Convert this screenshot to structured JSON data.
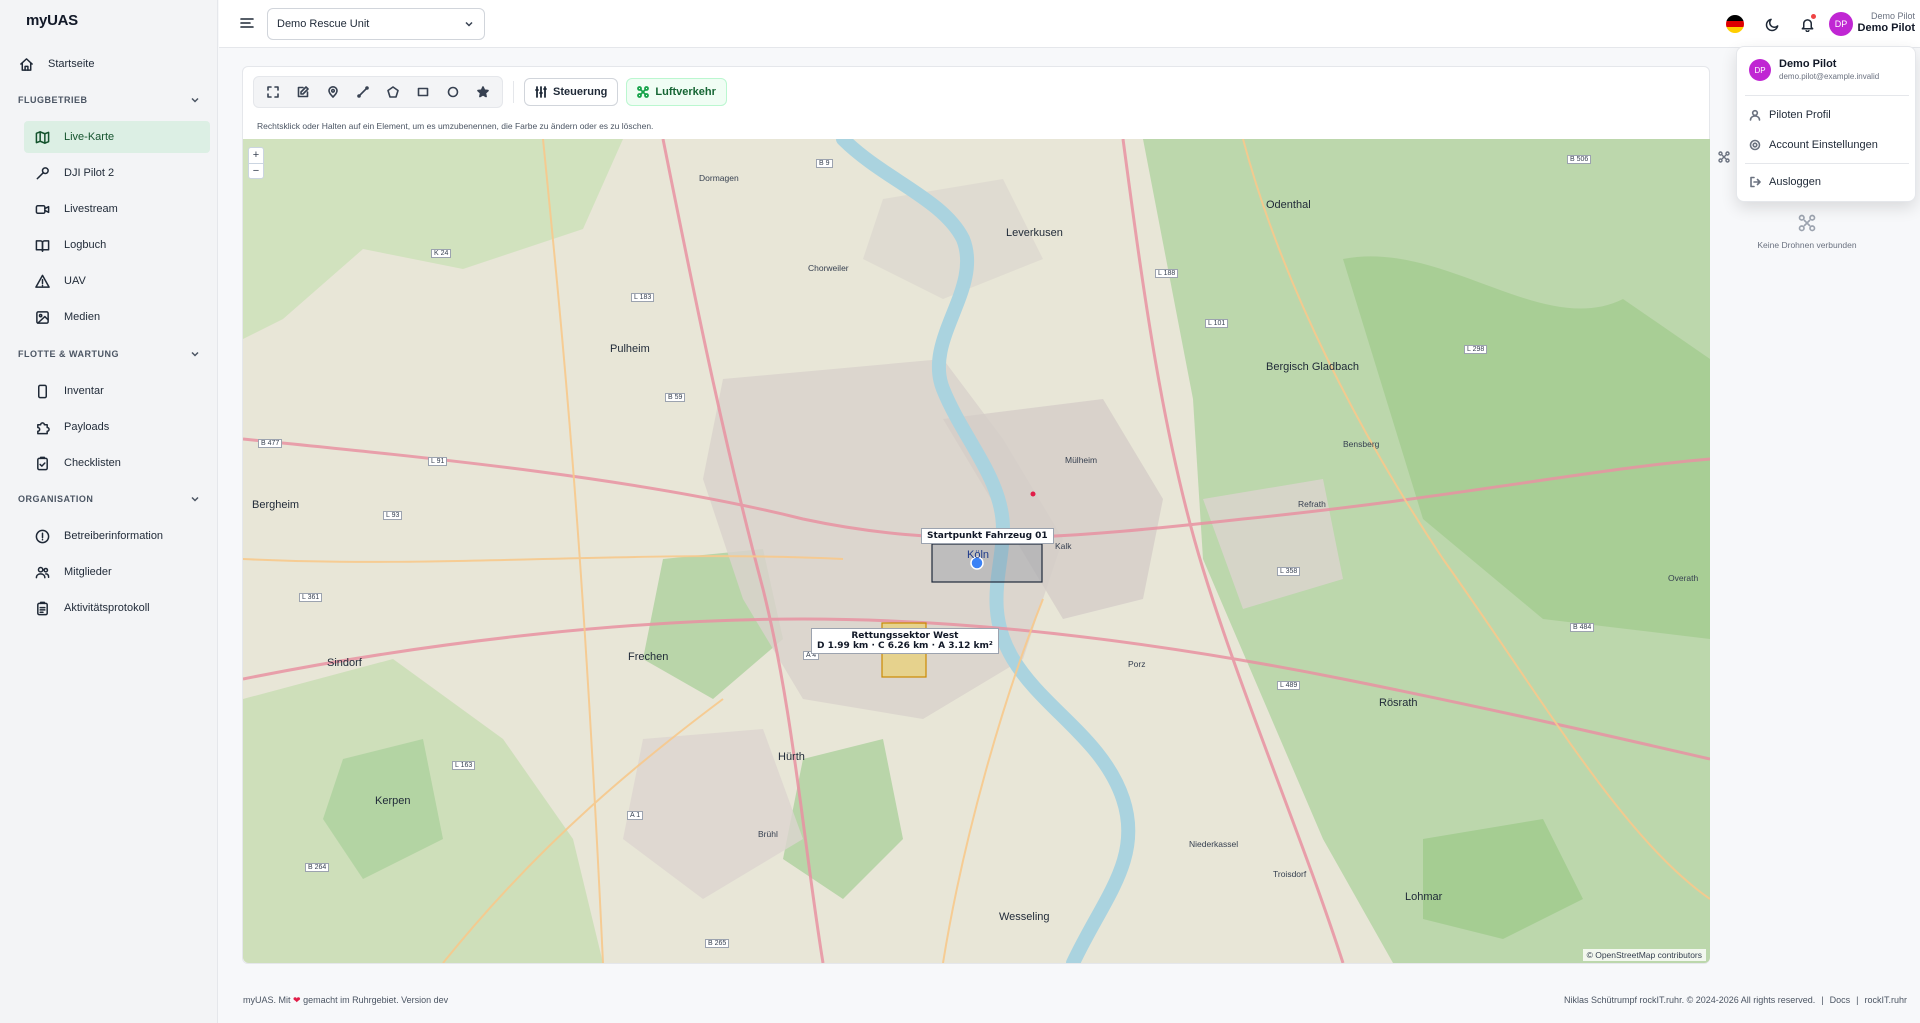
{
  "app": {
    "logo": "myUAS"
  },
  "sidebar": {
    "home": "Startseite",
    "sections": [
      {
        "title": "FLUGBETRIEB",
        "items": [
          "Live-Karte",
          "DJI Pilot 2",
          "Livestream",
          "Logbuch",
          "UAV",
          "Medien"
        ]
      },
      {
        "title": "FLOTTE & WARTUNG",
        "items": [
          "Inventar",
          "Payloads",
          "Checklisten"
        ]
      },
      {
        "title": "ORGANISATION",
        "items": [
          "Betreiberinformation",
          "Mitglieder",
          "Aktivitätsprotokoll"
        ]
      }
    ],
    "active": "Live-Karte"
  },
  "header": {
    "unit": "Demo Rescue Unit",
    "avatar_initials": "DP",
    "user_line1": "Demo Pilot",
    "user_line2": "Demo Pilot"
  },
  "toolbar": {
    "steuerung": "Steuerung",
    "luftverkehr": "Luftverkehr",
    "hint": "Rechtsklick oder Halten auf ein Element, um es umzubenennen, die Farbe zu ändern oder es zu löschen."
  },
  "map": {
    "zoom_in": "+",
    "zoom_out": "−",
    "marker_label": "Startpunkt Fahrzeug 01",
    "sector_title": "Rettungssektor West",
    "sector_stats": "D 1.99 km · C 6.26 km · A 3.12 km²",
    "attribution": "© OpenStreetMap contributors",
    "places": {
      "koeln": "Köln",
      "leverkusen": "Leverkusen",
      "bergisch_gladbach": "Bergisch Gladbach",
      "pulheim": "Pulheim",
      "frechen": "Frechen",
      "huerth": "Hürth",
      "kerpen": "Kerpen",
      "wesseling": "Wesseling",
      "odenthal": "Odenthal",
      "roesrath": "Rösrath",
      "lohmar": "Lohmar",
      "bergheim": "Bergheim",
      "sindorf": "Sindorf",
      "porz": "Porz",
      "muelheim": "Mülheim",
      "kalk": "Kalk",
      "chorweiler": "Chorweiler",
      "dormagen": "Dormagen",
      "overath": "Overath",
      "bruehl": "Brühl",
      "niederkassel": "Niederkassel",
      "troisdorf": "Troisdorf",
      "refrath": "Refrath",
      "bensberg": "Bensberg"
    },
    "roads": [
      "B 9",
      "B 506",
      "L 183",
      "B 59",
      "B 477",
      "L 91",
      "L 93",
      "L 361",
      "A 4",
      "L 163",
      "A 1",
      "B 264",
      "B 265",
      "L 188",
      "L 101",
      "L 298",
      "L 358",
      "L 489",
      "B 484",
      "K 24"
    ]
  },
  "right_panel": {
    "no_drone_text": "Keine Drohnen verbunden"
  },
  "user_menu": {
    "name": "Demo Pilot",
    "email": "demo.pilot@example.invalid",
    "items": [
      "Piloten Profil",
      "Account Einstellungen",
      "Ausloggen"
    ]
  },
  "footer": {
    "left_prefix": "myUAS. Mit",
    "left_suffix": "gemacht im Ruhrgebiet. Version dev",
    "right_copyright": "Niklas Schütrumpf rockIT.ruhr. © 2024-2026 All rights reserved.",
    "docs": "Docs",
    "site": "rockIT.ruhr"
  },
  "colors": {
    "accent": "#16a34a",
    "active_bg": "#dcefe4",
    "avatar": "#c026d3",
    "water": "#aad3df",
    "forest": "#add19e"
  }
}
